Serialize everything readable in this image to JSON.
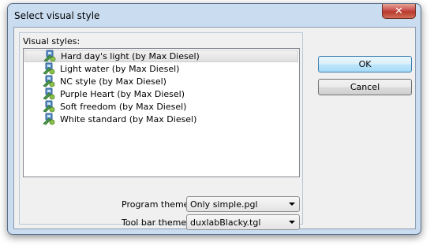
{
  "window": {
    "title": "Select visual style",
    "close_glyph": "✕"
  },
  "visual_styles": {
    "label": "Visual styles:",
    "items": [
      {
        "label": "Hard day's light (by Max Diesel)",
        "selected": true,
        "icon": "style-icon"
      },
      {
        "label": "Light water (by Max Diesel)",
        "selected": false,
        "icon": "style-icon"
      },
      {
        "label": "NC style (by Max Diesel)",
        "selected": false,
        "icon": "style-icon"
      },
      {
        "label": "Purple Heart (by Max Diesel)",
        "selected": false,
        "icon": "style-icon"
      },
      {
        "label": "Soft freedom (by Max Diesel)",
        "selected": false,
        "icon": "style-icon"
      },
      {
        "label": "White standard (by Max Diesel)",
        "selected": false,
        "icon": "style-icon"
      }
    ]
  },
  "program_theme": {
    "label": "Program theme",
    "value": "Only simple.pgl"
  },
  "toolbar_theme": {
    "label": "Tool bar theme",
    "value": "duxlabBlacky.tgl"
  },
  "buttons": {
    "ok": "OK",
    "cancel": "Cancel"
  }
}
